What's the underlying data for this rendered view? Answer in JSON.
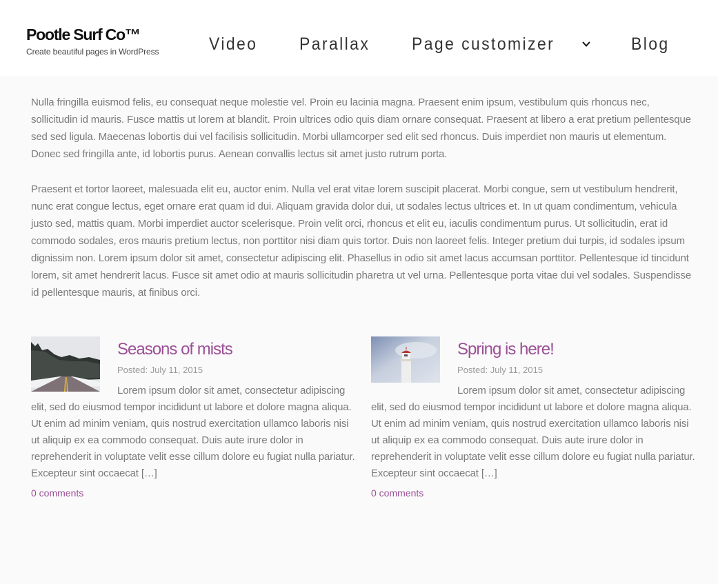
{
  "site": {
    "title": "Pootle Surf Co™",
    "tagline": "Create beautiful pages in WordPress"
  },
  "nav": {
    "items": [
      {
        "label": "Video"
      },
      {
        "label": "Parallax"
      },
      {
        "label": "Page customizer",
        "has_dropdown": true,
        "icon": "chevron-down-icon"
      },
      {
        "label": "Blog"
      }
    ]
  },
  "content": {
    "paragraphs": [
      "Nulla fringilla euismod felis, eu consequat neque molestie vel. Proin eu lacinia magna. Praesent enim ipsum, vestibulum quis rhoncus nec, sollicitudin id mauris. Fusce mattis ut lorem at blandit. Proin ultrices odio quis diam ornare consequat. Praesent at libero a erat pretium pellentesque sed sed ligula. Maecenas lobortis dui vel facilisis sollicitudin. Morbi ullamcorper sed elit sed rhoncus. Duis imperdiet non mauris ut elementum. Donec sed fringilla ante, id lobortis purus. Aenean convallis lectus sit amet justo rutrum porta.",
      "Praesent et tortor laoreet, malesuada elit eu, auctor enim. Nulla vel erat vitae lorem suscipit placerat. Morbi congue, sem ut vestibulum hendrerit, nunc erat congue lectus, eget ornare erat quam id dui. Aliquam gravida dolor dui, ut sodales lectus ultrices et. In ut quam condimentum, vehicula justo sed, mattis quam. Morbi imperdiet auctor scelerisque. Proin velit orci, rhoncus et elit eu, iaculis condimentum purus. Ut sollicitudin, erat id commodo sodales, eros mauris pretium lectus, non porttitor nisi diam quis tortor. Duis non laoreet felis. Integer pretium dui turpis, id sodales ipsum dignissim non. Lorem ipsum dolor sit amet, consectetur adipiscing elit. Phasellus in odio sit amet lacus accumsan porttitor. Pellentesque id tincidunt lorem, sit amet hendrerit lacus. Fusce sit amet odio at mauris sollicitudin pharetra ut vel urna. Pellentesque porta vitae dui vel sodales. Suspendisse id pellentesque mauris, at finibus orci."
    ]
  },
  "posts": [
    {
      "title": "Seasons of mists",
      "posted": "Posted: July 11, 2015",
      "thumbnail": "snowy-road-image",
      "excerpt": "Lorem ipsum dolor sit amet, consectetur adipiscing elit, sed do eiusmod tempor incididunt ut labore et dolore magna aliqua. Ut enim ad minim veniam, quis nostrud exercitation ullamco laboris nisi ut aliquip ex ea commodo consequat. Duis aute irure dolor in reprehenderit in voluptate velit esse cillum dolore eu fugiat nulla pariatur. Excepteur sint occaecat […]",
      "comments": "0 comments"
    },
    {
      "title": "Spring is here!",
      "posted": "Posted: July 11, 2015",
      "thumbnail": "lighthouse-image",
      "excerpt": "Lorem ipsum dolor sit amet, consectetur adipiscing elit, sed do eiusmod tempor incididunt ut labore et dolore magna aliqua. Ut enim ad minim veniam, quis nostrud exercitation ullamco laboris nisi ut aliquip ex ea commodo consequat. Duis aute irure dolor in reprehenderit in voluptate velit esse cillum dolore eu fugiat nulla pariatur. Excepteur sint occaecat […]",
      "comments": "0 comments"
    }
  ],
  "colors": {
    "accent": "#9b4f96",
    "header_bg": "#ffffff",
    "page_bg": "#fafafa",
    "body_text": "#7a7a7a"
  }
}
